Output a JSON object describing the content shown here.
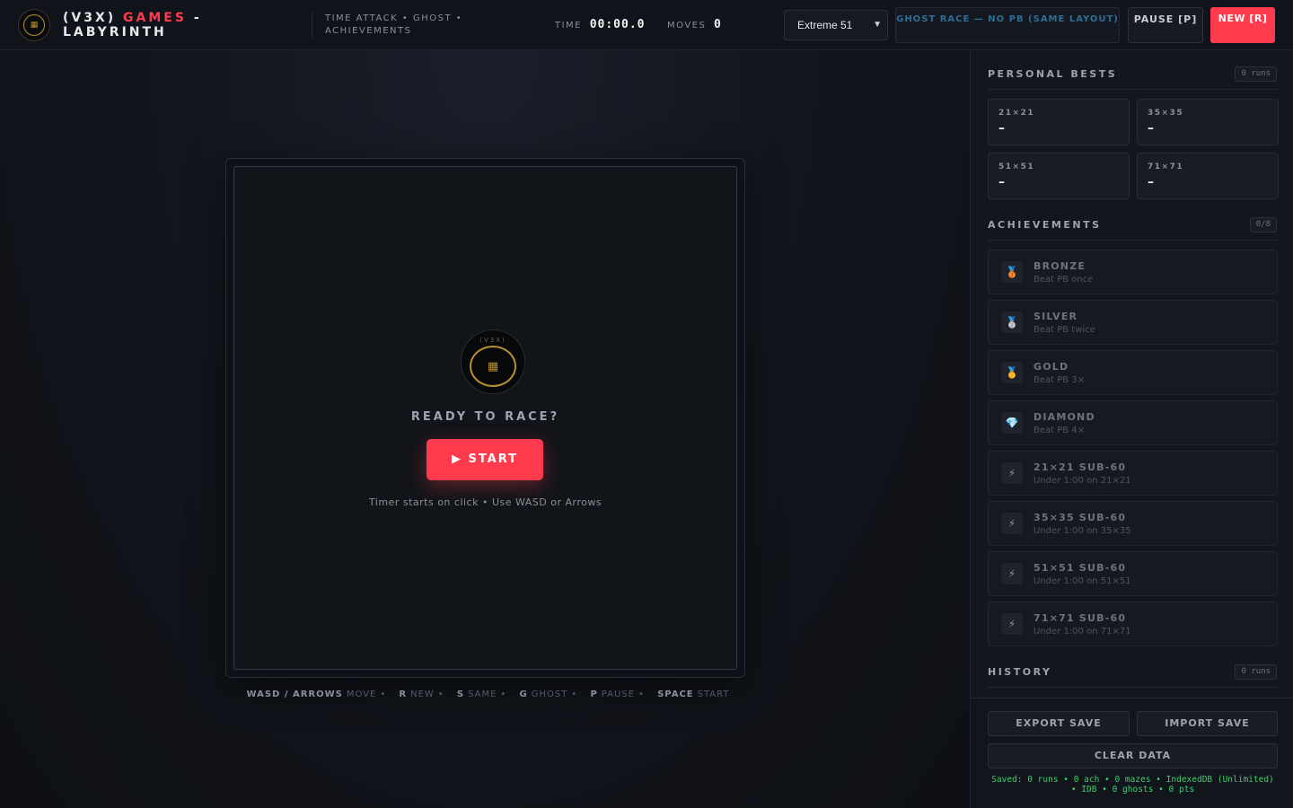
{
  "header": {
    "brand_prefix": "(V3X)",
    "brand_accent": "GAMES",
    "brand_suffix": "- LABYRINTH",
    "tagline": "TIME ATTACK • GHOST • ACHIEVEMENTS",
    "time_label": "TIME",
    "time_value": "00:00.0",
    "moves_label": "MOVES",
    "moves_value": "0",
    "difficulty_selected": "Extreme 51",
    "ghost_label": "GHOST RACE — NO PB (SAME LAYOUT)",
    "pause_label": "PAUSE [P]",
    "new_label": "NEW [R]"
  },
  "overlay": {
    "logo_text": "(V3X)",
    "ready": "READY TO RACE?",
    "start_label": "▶ START",
    "hint": "Timer starts on click • Use WASD or Arrows"
  },
  "shortcuts": [
    {
      "key": "WASD / ARROWS",
      "label": "MOVE"
    },
    {
      "key": "R",
      "label": "NEW"
    },
    {
      "key": "S",
      "label": "SAME"
    },
    {
      "key": "G",
      "label": "GHOST"
    },
    {
      "key": "P",
      "label": "PAUSE"
    },
    {
      "key": "SPACE",
      "label": "START"
    }
  ],
  "sidebar": {
    "personal_bests": {
      "title": "PERSONAL BESTS",
      "badge": "0 runs",
      "items": [
        {
          "label": "21×21",
          "value": "–"
        },
        {
          "label": "35×35",
          "value": "–"
        },
        {
          "label": "51×51",
          "value": "–"
        },
        {
          "label": "71×71",
          "value": "–"
        }
      ]
    },
    "achievements": {
      "title": "ACHIEVEMENTS",
      "badge": "0/8",
      "items": [
        {
          "icon": "bronze-medal-icon",
          "glyph": "🥉",
          "name": "BRONZE",
          "desc": "Beat PB once"
        },
        {
          "icon": "silver-medal-icon",
          "glyph": "🥈",
          "name": "SILVER",
          "desc": "Beat PB twice"
        },
        {
          "icon": "gold-medal-icon",
          "glyph": "🥇",
          "name": "GOLD",
          "desc": "Beat PB 3×"
        },
        {
          "icon": "diamond-icon",
          "glyph": "💎",
          "name": "DIAMOND",
          "desc": "Beat PB 4×"
        },
        {
          "icon": "lightning-icon",
          "glyph": "⚡",
          "name": "21×21 SUB-60",
          "desc": "Under 1:00 on 21×21"
        },
        {
          "icon": "lightning-icon",
          "glyph": "⚡",
          "name": "35×35 SUB-60",
          "desc": "Under 1:00 on 35×35"
        },
        {
          "icon": "lightning-icon",
          "glyph": "⚡",
          "name": "51×51 SUB-60",
          "desc": "Under 1:00 on 51×51"
        },
        {
          "icon": "lightning-icon",
          "glyph": "⚡",
          "name": "71×71 SUB-60",
          "desc": "Under 1:00 on 71×71"
        }
      ]
    },
    "history": {
      "title": "HISTORY",
      "badge": "0 runs"
    },
    "footer": {
      "export_label": "EXPORT SAVE",
      "import_label": "IMPORT SAVE",
      "clear_label": "CLEAR DATA",
      "saved_status": "Saved: 0 runs • 0 ach • 0 mazes • IndexedDB (Unlimited) • IDB • 0 ghosts • 0 pts"
    }
  },
  "colors": {
    "accent": "#ff3b4d",
    "gold": "#b8912e",
    "ghost_text": "#2e6e93",
    "saved_text": "#3ccf6e"
  }
}
